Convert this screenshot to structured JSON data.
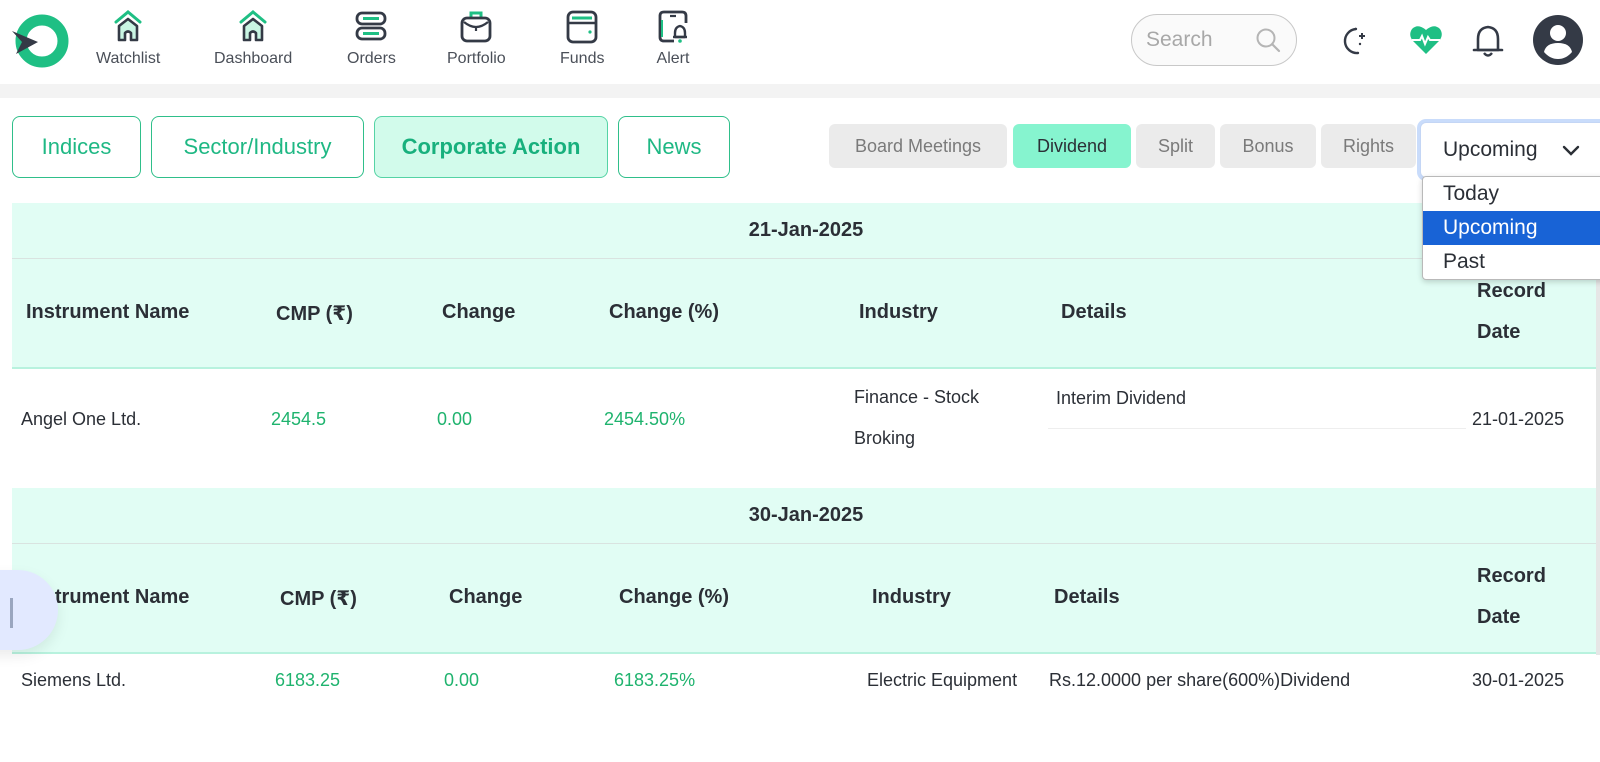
{
  "navbar": {
    "items": [
      {
        "label": "Watchlist",
        "icon": "home-icon"
      },
      {
        "label": "Dashboard",
        "icon": "home-icon"
      },
      {
        "label": "Orders",
        "icon": "orders-icon"
      },
      {
        "label": "Portfolio",
        "icon": "briefcase-icon"
      },
      {
        "label": "Funds",
        "icon": "wallet-icon"
      },
      {
        "label": "Alert",
        "icon": "phone-bell-icon"
      }
    ],
    "search_placeholder": "Search",
    "icons": [
      "moon-stars-icon",
      "heart-pulse-icon",
      "bell-icon",
      "user-avatar-icon"
    ]
  },
  "colors": {
    "brand_green": "#1fbf84",
    "dark": "#343a46",
    "tab_active_bg": "#d2fbeb",
    "subtab_active_bg": "#86f4cf",
    "table_header_bg": "#e1fdf4",
    "positive": "#1fb36e",
    "dropdown_selected": "#1863d6"
  },
  "main_tabs": [
    {
      "label": "Indices",
      "active": false
    },
    {
      "label": "Sector/Industry",
      "active": false
    },
    {
      "label": "Corporate Action",
      "active": true
    },
    {
      "label": "News",
      "active": false
    }
  ],
  "sub_tabs": [
    {
      "label": "Board Meetings",
      "active": false
    },
    {
      "label": "Dividend",
      "active": true
    },
    {
      "label": "Split",
      "active": false
    },
    {
      "label": "Bonus",
      "active": false
    },
    {
      "label": "Rights",
      "active": false
    }
  ],
  "period_select": {
    "value": "Upcoming",
    "options": [
      "Today",
      "Upcoming",
      "Past"
    ],
    "highlighted": "Upcoming"
  },
  "columns": [
    "Instrument Name",
    "CMP (₹)",
    "Change",
    "Change (%)",
    "Industry",
    "Details",
    "Record",
    "Date"
  ],
  "groups": [
    {
      "date": "21-Jan-2025",
      "rows": [
        {
          "instrument": "Angel One Ltd.",
          "cmp": "2454.5",
          "change": "0.00",
          "change_pct": "2454.50%",
          "industry_line1": "Finance - Stock",
          "industry_line2": "Broking",
          "details": "Interim Dividend",
          "record_date": "21-01-2025"
        }
      ]
    },
    {
      "date": "30-Jan-2025",
      "rows": [
        {
          "instrument": "Siemens Ltd.",
          "cmp": "6183.25",
          "change": "0.00",
          "change_pct": "6183.25%",
          "industry": "Electric Equipment",
          "details": "Rs.12.0000 per share(600%)Dividend",
          "record_date": "30-01-2025"
        }
      ]
    }
  ]
}
